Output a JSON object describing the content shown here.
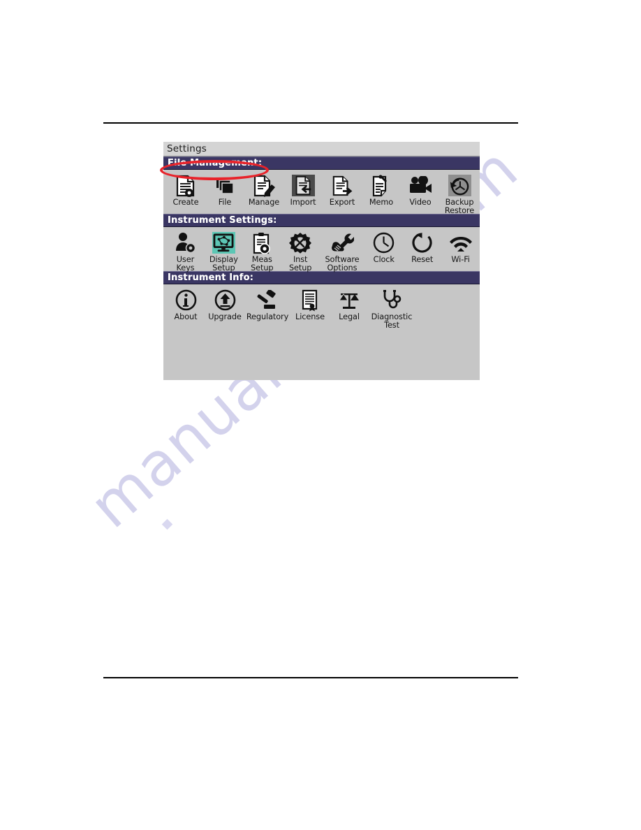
{
  "page": {
    "watermark_text": "manualshive.com"
  },
  "device": {
    "titlebar": {
      "title": "Settings"
    },
    "sections": [
      {
        "id": "file-management",
        "header": "File Management:",
        "items": [
          {
            "label": "Create",
            "icon": "document-new-icon",
            "tile": "none"
          },
          {
            "label": "File",
            "icon": "file-stack-icon",
            "tile": "none"
          },
          {
            "label": "Manage",
            "icon": "document-edit-icon",
            "tile": "none"
          },
          {
            "label": "Import",
            "icon": "document-import-icon",
            "tile": "dark"
          },
          {
            "label": "Export",
            "icon": "document-export-icon",
            "tile": "none"
          },
          {
            "label": "Memo",
            "icon": "memo-pen-icon",
            "tile": "none"
          },
          {
            "label": "Video",
            "icon": "video-camera-icon",
            "tile": "none"
          },
          {
            "label": "Backup\nRestore",
            "icon": "backup-restore-icon",
            "tile": "gray"
          }
        ]
      },
      {
        "id": "instrument-settings",
        "header": "Instrument Settings:",
        "items": [
          {
            "label": "User\nKeys",
            "icon": "user-gear-icon",
            "tile": "none"
          },
          {
            "label": "Display\nSetup",
            "icon": "display-monitor-icon",
            "tile": "teal"
          },
          {
            "label": "Meas\nSetup",
            "icon": "clipboard-gear-icon",
            "tile": "none"
          },
          {
            "label": "Inst\nSetup",
            "icon": "gear-tools-icon",
            "tile": "none"
          },
          {
            "label": "Software\nOptions",
            "icon": "hand-wrench-icon",
            "tile": "none"
          },
          {
            "label": "Clock",
            "icon": "clock-icon",
            "tile": "none"
          },
          {
            "label": "Reset",
            "icon": "reset-arrow-icon",
            "tile": "none"
          },
          {
            "label": "Wi-Fi",
            "icon": "wifi-icon",
            "tile": "none"
          }
        ]
      },
      {
        "id": "instrument-info",
        "header": "Instrument Info:",
        "items": [
          {
            "label": "About",
            "icon": "info-circle-icon",
            "tile": "none"
          },
          {
            "label": "Upgrade",
            "icon": "upload-circle-icon",
            "tile": "none"
          },
          {
            "label": "Regulatory",
            "icon": "gavel-icon",
            "tile": "none"
          },
          {
            "label": "License",
            "icon": "certificate-icon",
            "tile": "none"
          },
          {
            "label": "Legal",
            "icon": "scales-icon",
            "tile": "none"
          },
          {
            "label": "Diagnostic\nTest",
            "icon": "stethoscope-icon",
            "tile": "none"
          }
        ]
      }
    ]
  },
  "annotation": {
    "shape": "ellipse",
    "target": "File Management:",
    "color": "#e8232a"
  },
  "colors": {
    "panel_background": "#c6c6c6",
    "titlebar_background": "#d4d4d4",
    "section_header_background": "#3a3663",
    "section_header_text": "#ffffff",
    "annotation_red": "#e8232a",
    "display_tile_teal": "#5cc6b4",
    "watermark_purple": "#b9b8e2"
  }
}
